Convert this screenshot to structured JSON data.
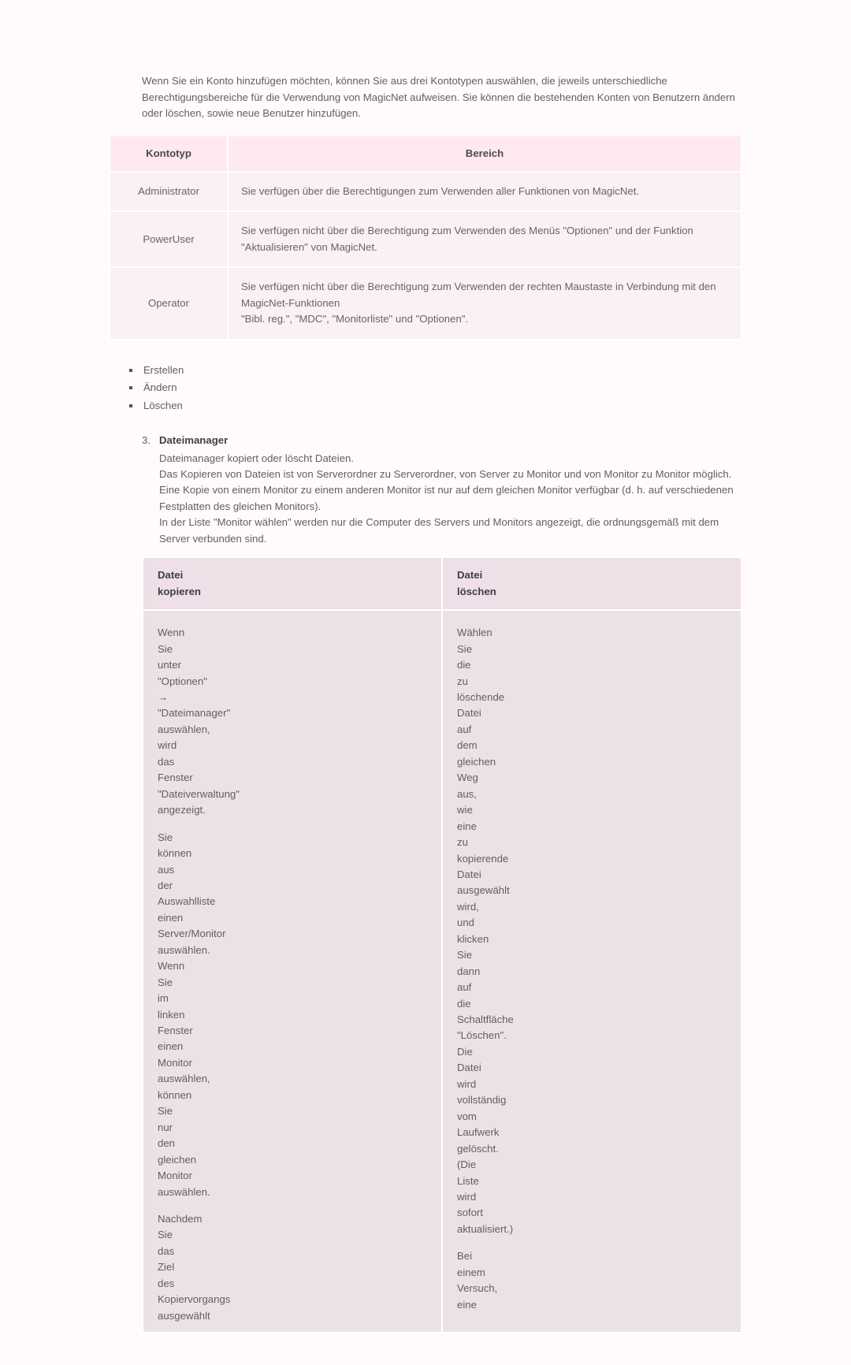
{
  "intro": "Wenn Sie ein Konto hinzufügen möchten, können Sie aus drei Kontotypen auswählen, die jeweils unterschiedliche Berechtigungsbereiche für die Verwendung von MagicNet aufweisen. Sie können die bestehenden Konten von Benutzern ändern oder löschen, sowie neue Benutzer hinzufügen.",
  "konto_table": {
    "headers": {
      "type": "Kontotyp",
      "scope": "Bereich"
    },
    "rows": [
      {
        "type": "Administrator",
        "scope": "Sie verfügen über die Berechtigungen zum Verwenden aller Funktionen von MagicNet."
      },
      {
        "type": "PowerUser",
        "scope": "Sie verfügen nicht über die Berechtigung zum Verwenden des Menüs \"Optionen\" und der Funktion \"Aktualisieren\" von MagicNet."
      },
      {
        "type": "Operator",
        "scope": "Sie verfügen nicht über die Berechtigung zum Verwenden der rechten Maustaste in Verbindung mit den MagicNet-Funktionen\n\"Bibl. reg.\", \"MDC\", \"Monitorliste\" und \"Optionen\"."
      }
    ]
  },
  "actions": [
    "Erstellen",
    "Ändern",
    "Löschen"
  ],
  "section3": {
    "number": "3.",
    "title": "Dateimanager",
    "body": "Dateimanager kopiert oder löscht Dateien.\nDas Kopieren von Dateien ist von Serverordner zu Serverordner, von Server zu Monitor und von Monitor zu Monitor möglich.\nEine Kopie von einem Monitor zu einem anderen Monitor ist nur auf dem gleichen Monitor verfügbar (d. h. auf verschiedenen Festplatten des gleichen Monitors).\nIn der Liste \"Monitor wählen\" werden nur die Computer des Servers und Monitors angezeigt, die ordnungsgemäß mit dem Server verbunden sind."
  },
  "file_table": {
    "headers": {
      "copy": "Datei\nkopieren",
      "delete": "Datei\nlöschen"
    },
    "copy": {
      "p1": "Wenn Sie unter \"Optionen\" → \"Dateimanager\" auswählen, wird das Fenster \"Dateiverwaltung\" angezeigt.",
      "p2": "Sie können aus der Auswahlliste einen Server/Monitor auswählen. Wenn Sie im linken Fenster einen Monitor auswählen, können Sie nur den gleichen Monitor auswählen.",
      "p3": "Nachdem Sie das Ziel des Kopiervorgangs ausgewählt"
    },
    "delete": {
      "p1": "Wählen Sie die zu löschende Datei auf dem gleichen Weg aus, wie eine zu kopierende Datei ausgewählt wird, und klicken Sie dann auf die Schaltfläche \"Löschen\". Die Datei wird vollständig vom Laufwerk gelöscht. (Die Liste wird sofort aktualisiert.)",
      "p2": "Bei einem Versuch, eine"
    }
  }
}
